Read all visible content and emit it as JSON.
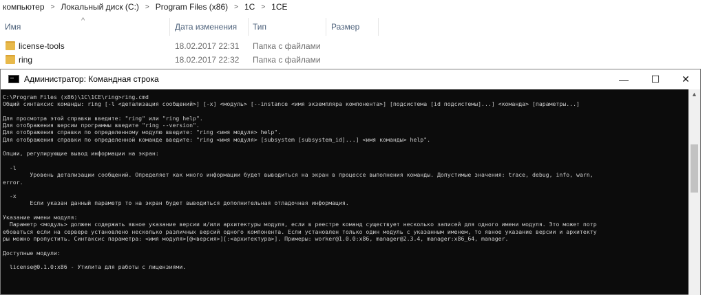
{
  "breadcrumb": [
    "компьютер",
    "Локальный диск (C:)",
    "Program Files (x86)",
    "1C",
    "1CE"
  ],
  "columns": {
    "name": "Имя",
    "date": "Дата изменения",
    "type": "Тип",
    "size": "Размер"
  },
  "files": [
    {
      "name": "license-tools",
      "date": "18.02.2017 22:31",
      "type": "Папка с файлами"
    },
    {
      "name": "ring",
      "date": "18.02.2017 22:32",
      "type": "Папка с файлами"
    }
  ],
  "console": {
    "title": "Администратор: Командная строка",
    "minimize": "—",
    "maximize": "☐",
    "close": "✕",
    "lines": [
      "C:\\Program Files (x86)\\1C\\1CE\\ring>ring.cmd",
      "Общий синтаксис команды: ring [-l <детализация сообщений>] [-x] <модуль> [--instance <имя экземпляра компонента>] [подсистема [id подсистемы]...] <команда> [параметры...]",
      "",
      "Для просмотра этой справки введите: \"ring\" или \"ring help\".",
      "Для отображения версии программы введите \"ring --version\".",
      "Для отображения справки по определенному модулю введите: \"ring <имя модуля> help\".",
      "Для отображения справки по определенной команде введите: \"ring <имя модуля> [subsystem [subsystem_id]...] <имя команды> help\".",
      "",
      "Опции, регулирующие вывод информации на экран:",
      "",
      "  -l",
      "        Уровень детализации сообщений. Определяет как много информации будет выводиться на экран в процессе выполнения команды. Допустимые значения: trace, debug, info, warn,",
      "error.",
      "",
      "  -x",
      "        Если указан данный параметр то на экран будет выводиться дополнительная отладочная информация.",
      "",
      "Указание имени модуля:",
      "  Параметр <модуль> должен содержать явное указание версии и/или архитектуры модуля, если в реестре команд существует несколько записей для одного имени модуля. Это может потр",
      "ебоваться если на сервере установлено несколько различных версий одного компонента. Если установлен только один модуль с указанным именем, то явное указание версии и архитекту",
      "ры можно пропустить. Синтаксис параметра: <имя модуля>[@<версия>][:<архитектура>]. Примеры: worker@1.0.0:x86, manager@2.3.4, manager:x86_64, manager.",
      "",
      "Доступные модули:",
      "",
      "  license@0.1.0:x86 - Утилита для работы с лицензиями."
    ]
  }
}
